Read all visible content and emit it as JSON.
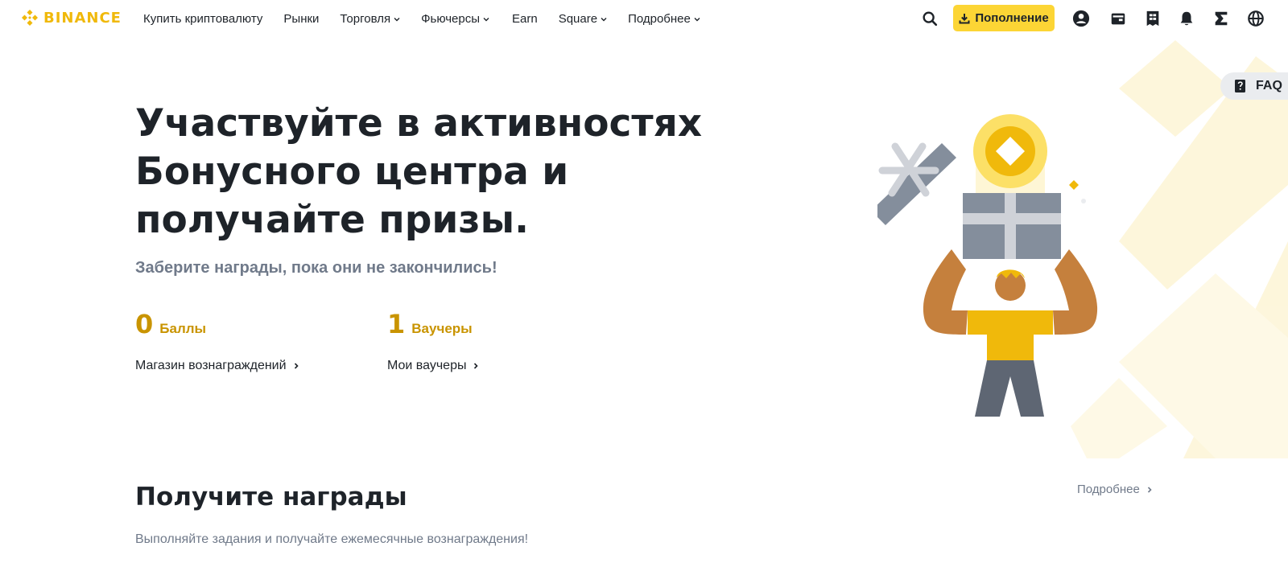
{
  "header": {
    "logo_text": "BINANCE",
    "nav": [
      {
        "label": "Купить криптовалюту",
        "has_dropdown": false
      },
      {
        "label": "Рынки",
        "has_dropdown": false
      },
      {
        "label": "Торговля",
        "has_dropdown": true
      },
      {
        "label": "Фьючерсы",
        "has_dropdown": true
      },
      {
        "label": "Earn",
        "has_dropdown": false
      },
      {
        "label": "Square",
        "has_dropdown": true
      },
      {
        "label": "Подробнее",
        "has_dropdown": true
      }
    ],
    "deposit_label": "Пополнение",
    "icons": [
      "search-icon",
      "user-icon",
      "wallet-icon",
      "orders-icon",
      "bell-icon",
      "download-icon",
      "globe-icon"
    ]
  },
  "faq": {
    "label": "FAQ"
  },
  "hero": {
    "title": "Участвуйте в активностях Бонусного центра и получайте призы.",
    "subtitle": "Заберите награды, пока они не закончились!",
    "stats": [
      {
        "value": "0",
        "label": "Баллы",
        "link": "Магазин вознаграждений"
      },
      {
        "value": "1",
        "label": "Ваучеры",
        "link": "Мои ваучеры"
      }
    ]
  },
  "section": {
    "title": "Получите награды",
    "subtitle": "Выполняйте задания и получайте ежемесячные вознаграждения!",
    "more": "Подробнее"
  },
  "colors": {
    "brand": "#f0b90b",
    "button": "#fcd535",
    "accent_text": "#c99400",
    "text": "#1e2329",
    "muted": "#707a8a"
  }
}
